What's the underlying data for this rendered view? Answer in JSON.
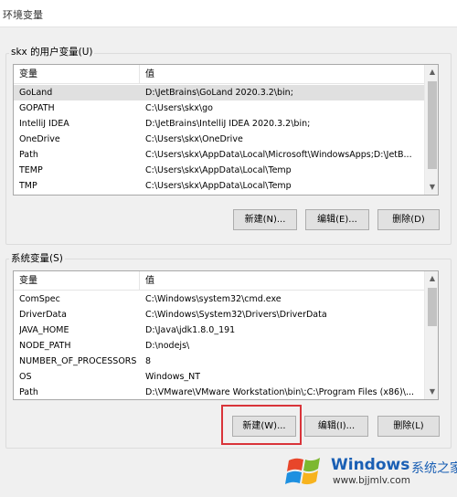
{
  "window": {
    "title": "环境变量"
  },
  "user_section": {
    "label": "skx 的用户变量(U)",
    "columns": [
      "变量",
      "值"
    ],
    "rows": [
      {
        "name": "GoLand",
        "value": "D:\\JetBrains\\GoLand 2020.3.2\\bin;"
      },
      {
        "name": "GOPATH",
        "value": "C:\\Users\\skx\\go"
      },
      {
        "name": "IntelliJ IDEA",
        "value": "D:\\JetBrains\\IntelliJ IDEA 2020.3.2\\bin;"
      },
      {
        "name": "OneDrive",
        "value": "C:\\Users\\skx\\OneDrive"
      },
      {
        "name": "Path",
        "value": "C:\\Users\\skx\\AppData\\Local\\Microsoft\\WindowsApps;D:\\JetB..."
      },
      {
        "name": "TEMP",
        "value": "C:\\Users\\skx\\AppData\\Local\\Temp"
      },
      {
        "name": "TMP",
        "value": "C:\\Users\\skx\\AppData\\Local\\Temp"
      }
    ],
    "buttons": {
      "new": "新建(N)...",
      "edit": "编辑(E)...",
      "delete": "删除(D)"
    }
  },
  "system_section": {
    "label": "系统变量(S)",
    "columns": [
      "变量",
      "值"
    ],
    "rows": [
      {
        "name": "ComSpec",
        "value": "C:\\Windows\\system32\\cmd.exe"
      },
      {
        "name": "DriverData",
        "value": "C:\\Windows\\System32\\Drivers\\DriverData"
      },
      {
        "name": "JAVA_HOME",
        "value": "D:\\Java\\jdk1.8.0_191"
      },
      {
        "name": "NODE_PATH",
        "value": "D:\\nodejs\\"
      },
      {
        "name": "NUMBER_OF_PROCESSORS",
        "value": "8"
      },
      {
        "name": "OS",
        "value": "Windows_NT"
      },
      {
        "name": "Path",
        "value": "D:\\VMware\\VMware Workstation\\bin\\;C:\\Program Files (x86)\\..."
      }
    ],
    "buttons": {
      "new": "新建(W)...",
      "edit": "编辑(I)...",
      "delete": "删除(L)"
    }
  },
  "watermark": {
    "brand": "Windows",
    "brand_cn": "系统之家",
    "url": "www.bjjmlv.com"
  },
  "colors": {
    "highlight": "#d9343a",
    "selected_row": "#e0e0e0",
    "brand": "#1a5fb4"
  }
}
